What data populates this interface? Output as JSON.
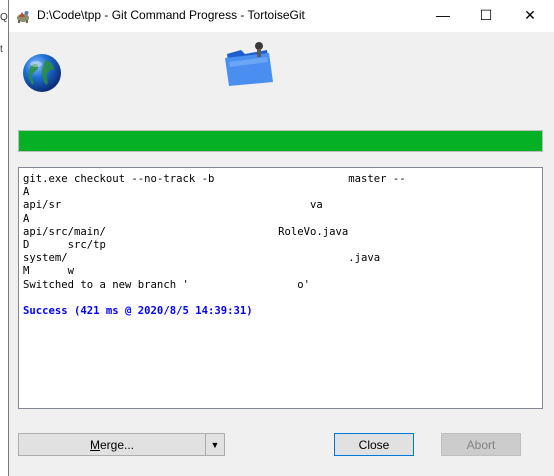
{
  "window": {
    "title": "D:\\Code\\tpp - Git Command Progress - TortoiseGit",
    "controls": {
      "minimize": "—",
      "maximize": "☐",
      "close": "✕"
    }
  },
  "edge_glyphs": [
    "Q",
    "t"
  ],
  "progress": {
    "percent": 100,
    "color": "#06b025"
  },
  "log": {
    "lines": [
      "git.exe checkout --no-track -b                     master --",
      "A",
      "api/sr                                       va",
      "A",
      "api/src/main/                           RoleVo.java",
      "D      src/tp",
      "system/                                            .java",
      "M      w",
      "Switched to a new branch '                 o'"
    ],
    "status": "Success (421 ms @ 2020/8/5 14:39:31)"
  },
  "buttons": {
    "merge_accel": "M",
    "merge_rest": "erge...",
    "merge_dropdown": "▼",
    "close": "Close",
    "abort": "Abort"
  },
  "colors": {
    "status_text": "#0000ff",
    "close_border": "#0078d7"
  }
}
